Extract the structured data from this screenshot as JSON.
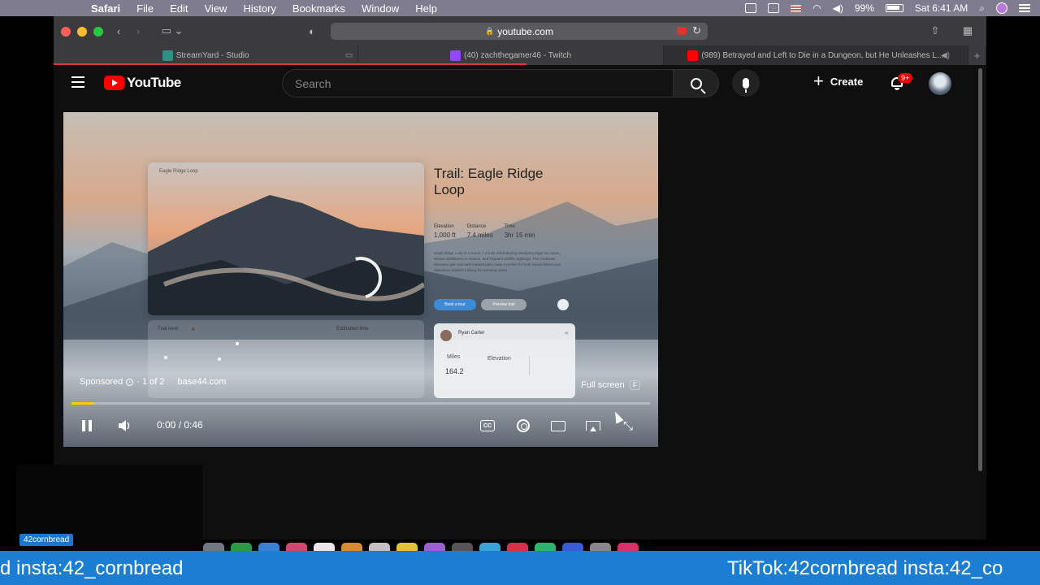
{
  "menubar": {
    "apple_icon": "apple-icon",
    "items": [
      "Safari",
      "File",
      "Edit",
      "View",
      "History",
      "Bookmarks",
      "Window",
      "Help"
    ],
    "battery": "99%",
    "datetime": "Sat 6:41 AM"
  },
  "safari": {
    "address": "youtube.com",
    "tabs": [
      {
        "title": "StreamYard - Studio",
        "favicon_color": "#2f8f83"
      },
      {
        "title": "(40) zachthegamer46 - Twitch",
        "favicon_color": "#9146ff"
      },
      {
        "title": "(989) Betrayed and Left to Die in a Dungeon, but He Unleashes L...",
        "favicon_color": "#ff0000"
      }
    ]
  },
  "youtube": {
    "logo_text": "YouTube",
    "search_placeholder": "Search",
    "create_label": "Create",
    "notifications_badge": "9+",
    "accent_color": "#ff0000"
  },
  "video": {
    "ad": {
      "small_title": "Eagle Ridge Loop",
      "trail_title": "Trail: Eagle Ridge Loop",
      "stats": [
        {
          "label": "Elevation",
          "value": "1,000 ft"
        },
        {
          "label": "Distance",
          "value": "7.4 miles"
        },
        {
          "label": "Time",
          "value": "3hr 15 min"
        }
      ],
      "description": "Eagle Ridge Loop is a scenic 7.4-mile trail featuring sweeping ridge-top views, vibrant wildflowers in season, and frequent wildlife sightings. The moderate elevation gain and well-marked path make it perfect for both casual hikers and adventure seekers looking for stunning vistas.",
      "book_button": "Book a tour",
      "preview_button": "Preview trail",
      "trail_level_label": "Trail level",
      "trail_level_value": "4",
      "estimated_time_label": "Estimated time",
      "profile_name": "Ryan Carter",
      "miles_label": "Miles",
      "miles_value": "164.2",
      "elevation_label": "Elevation"
    },
    "sponsored_label": "Sponsored",
    "ad_count": "· 1 of 2",
    "ad_site": "base44.com",
    "fullscreen_tooltip": "Full screen",
    "fullscreen_key": "F",
    "time": "0:00 / 0:46",
    "progress_fraction": 0.04,
    "cc_label": "CC"
  },
  "overlay": {
    "cam_label": "42cornbread",
    "banner_text_left": "d insta:42_cornbread",
    "banner_text_right": "TikTok:42cornbread insta:42_co"
  }
}
